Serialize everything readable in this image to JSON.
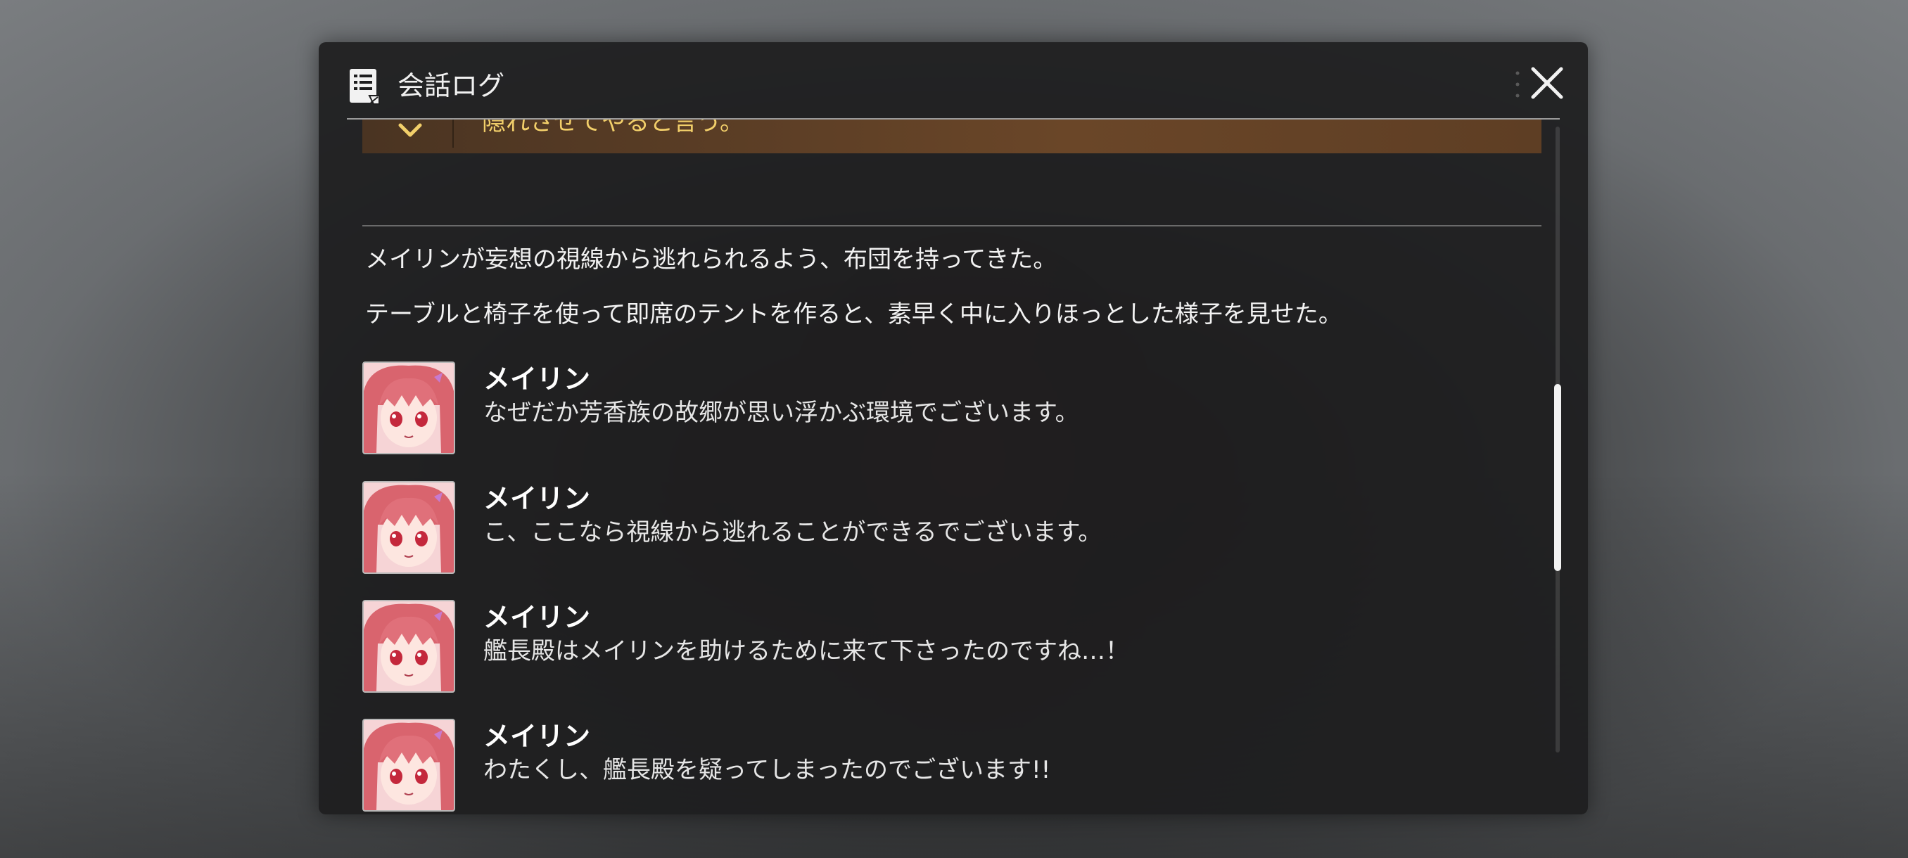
{
  "header": {
    "title": "会話ログ",
    "icon": "log-document-icon",
    "close_icon": "close-icon"
  },
  "choice": {
    "text": "隠れさせてやると言う。",
    "color": "#f2cf6a"
  },
  "narration": [
    "メイリンが妄想の視線から逃れられるよう、布団を持ってきた。",
    "テーブルと椅子を使って即席のテントを作ると、素早く中に入りほっとした様子を見せた。"
  ],
  "entries": [
    {
      "speaker": "メイリン",
      "text": "なぜだか芳香族の故郷が思い浮かぶ環境でございます。"
    },
    {
      "speaker": "メイリン",
      "text": "こ、ここなら視線から逃れることができるでございます。"
    },
    {
      "speaker": "メイリン",
      "text": "艦長殿はメイリンを助けるために来て下さったのですね…！"
    },
    {
      "speaker": "メイリン",
      "text": "わたくし、艦長殿を疑ってしまったのでございます!!"
    }
  ]
}
